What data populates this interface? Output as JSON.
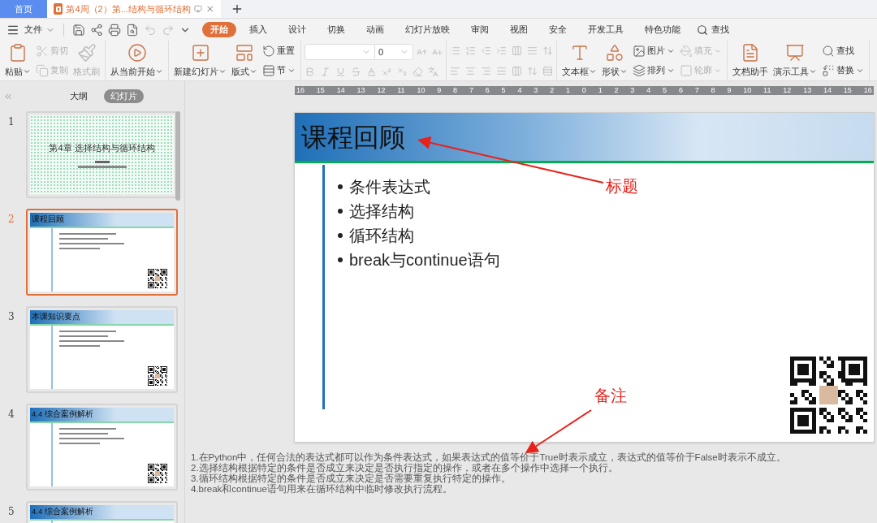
{
  "tabs": [
    {
      "kind": "home",
      "label": "首页",
      "selected": false
    },
    {
      "kind": "document",
      "label": "第4周（2）第...结构与循环结构",
      "selected": true
    }
  ],
  "menu": {
    "file": "文件",
    "tabs": [
      {
        "label": "开始",
        "selected": true
      },
      {
        "label": "插入",
        "selected": false
      },
      {
        "label": "设计",
        "selected": false
      },
      {
        "label": "切换",
        "selected": false
      },
      {
        "label": "动画",
        "selected": false
      },
      {
        "label": "幻灯片放映",
        "selected": false
      },
      {
        "label": "审阅",
        "selected": false
      },
      {
        "label": "视图",
        "selected": false
      },
      {
        "label": "安全",
        "selected": false
      },
      {
        "label": "开发工具",
        "selected": false
      },
      {
        "label": "特色功能",
        "selected": false
      }
    ],
    "search": "查找"
  },
  "ribbon": {
    "groups": [
      {
        "kind": "buttons",
        "items": [
          {
            "label": "粘贴",
            "kind": "large",
            "dropdown": true,
            "disabled": false
          },
          {
            "label": "剪切",
            "kind": "small",
            "dropdown": false,
            "disabled": true
          },
          {
            "label": "复制",
            "kind": "small",
            "dropdown": false,
            "disabled": true
          },
          {
            "label": "格式刷",
            "kind": "large",
            "dropdown": false,
            "disabled": true
          }
        ]
      },
      {
        "kind": "buttons",
        "items": [
          {
            "label": "从当前开始",
            "kind": "large",
            "dropdown": true,
            "disabled": false
          }
        ]
      },
      {
        "kind": "buttons",
        "items": [
          {
            "label": "新建幻灯片",
            "kind": "large",
            "dropdown": true,
            "disabled": false
          },
          {
            "label": "版式",
            "kind": "large",
            "dropdown": true,
            "disabled": false
          },
          {
            "label": "重置",
            "kind": "small",
            "dropdown": false,
            "disabled": false
          },
          {
            "label": "节",
            "kind": "small",
            "dropdown": true,
            "disabled": false
          }
        ]
      },
      {
        "kind": "font",
        "size_value": "0"
      },
      {
        "kind": "paragraph"
      },
      {
        "kind": "buttons",
        "items": [
          {
            "label": "文本框",
            "kind": "large",
            "dropdown": true,
            "disabled": false
          },
          {
            "label": "形状",
            "kind": "large",
            "dropdown": true,
            "disabled": false
          },
          {
            "label": "图片",
            "kind": "small",
            "dropdown": true,
            "disabled": false
          },
          {
            "label": "排列",
            "kind": "small",
            "dropdown": true,
            "disabled": false
          },
          {
            "label": "填充",
            "kind": "small",
            "dropdown": true,
            "disabled": true
          },
          {
            "label": "轮廓",
            "kind": "small",
            "dropdown": true,
            "disabled": true
          }
        ]
      },
      {
        "kind": "buttons",
        "items": [
          {
            "label": "文档助手",
            "kind": "large",
            "dropdown": false,
            "disabled": false
          },
          {
            "label": "演示工具",
            "kind": "large",
            "dropdown": true,
            "disabled": false
          },
          {
            "label": "查找",
            "kind": "small",
            "dropdown": false,
            "disabled": false
          },
          {
            "label": "替换",
            "kind": "small",
            "dropdown": true,
            "disabled": false
          }
        ]
      }
    ]
  },
  "panel": {
    "tabs": [
      {
        "label": "大纲",
        "selected": false
      },
      {
        "label": "幻灯片",
        "selected": true
      }
    ],
    "slides": [
      {
        "number": "1",
        "kind": "cover",
        "title": "第4章  选择结构与循环结构",
        "selected": false
      },
      {
        "number": "2",
        "kind": "content",
        "title": "课程回顾",
        "selected": true
      },
      {
        "number": "3",
        "kind": "content",
        "title": "本课知识要点",
        "selected": false
      },
      {
        "number": "4",
        "kind": "content",
        "title": "4.4  综合案例解析",
        "selected": false
      },
      {
        "number": "5",
        "kind": "content",
        "title": "4.4  综合案例解析",
        "selected": false
      }
    ]
  },
  "ruler": [
    "16",
    "15",
    "14",
    "13",
    "12",
    "11",
    "10",
    "9",
    "8",
    "7",
    "6",
    "5",
    "4",
    "3",
    "2",
    "1",
    "0",
    "1",
    "2",
    "3",
    "4",
    "5",
    "6",
    "7",
    "8",
    "9",
    "10",
    "11",
    "12",
    "13",
    "14",
    "15",
    "16"
  ],
  "slide": {
    "title": "课程回顾",
    "bullets": [
      "条件表达式",
      "选择结构",
      "循环结构",
      "break与continue语句"
    ]
  },
  "annotations": [
    {
      "label": "标题"
    },
    {
      "label": "备注"
    }
  ],
  "notes": [
    "1.在Python中，任何合法的表达式都可以作为条件表达式，如果表达式的值等价于True时表示成立，表达式的值等价于False时表示不成立。",
    "2.选择结构根据特定的条件是否成立来决定是否执行指定的操作，或者在多个操作中选择一个执行。",
    "3.循环结构根据特定的条件是否成立来决定是否需要重复执行特定的操作。",
    "4.break和continue语句用来在循环结构中临时修改执行流程。"
  ]
}
